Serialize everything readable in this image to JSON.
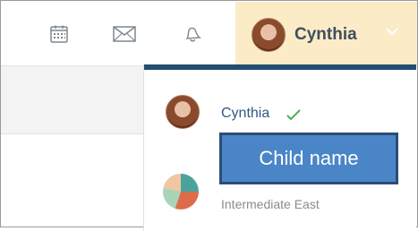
{
  "header": {
    "icons": [
      {
        "name": "calendar-icon"
      },
      {
        "name": "mail-icon"
      },
      {
        "name": "bell-icon"
      }
    ],
    "user": {
      "name": "Cynthia"
    }
  },
  "dropdown": {
    "selected_child": "Cynthia",
    "class_name": "Intermediate East"
  },
  "annotation": {
    "label": "Child name"
  },
  "colors": {
    "accent": "#214e72",
    "user_tab_bg": "#fbebc7",
    "check": "#4caf50",
    "callout_bg": "#4a86c7"
  }
}
